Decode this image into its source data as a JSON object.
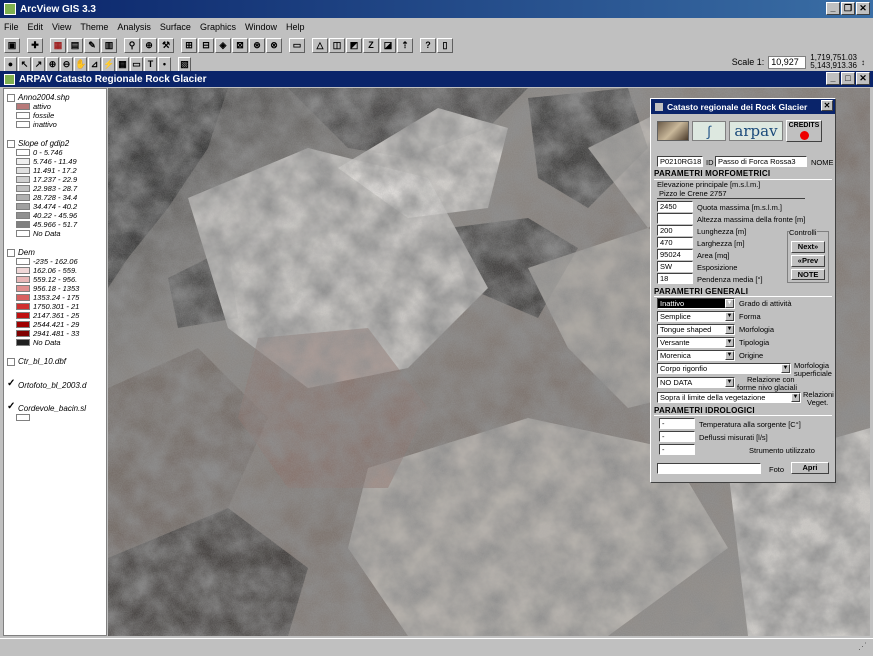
{
  "app": {
    "title": "ArcView GIS 3.3"
  },
  "menu": [
    "File",
    "Edit",
    "View",
    "Theme",
    "Analysis",
    "Surface",
    "Graphics",
    "Window",
    "Help"
  ],
  "toolbar": {
    "row1": [
      "save-icon",
      "add-theme-icon",
      "theme-props-icon",
      "legend-icon",
      "edit-icon",
      "table-icon",
      "zoom-full-icon",
      "zoom-active-icon",
      "zoom-selected-icon",
      "zoom-in-icon",
      "zoom-out-icon",
      "select-icon",
      "clear-icon",
      "query-icon",
      "locate-icon",
      "zoom-previous-icon",
      "layout-icon",
      "chart-icon",
      "triangle-icon",
      "chart2-icon",
      "chart3-icon",
      "text-icon",
      "bold-icon",
      "help-icon",
      "help2-icon"
    ],
    "row2": [
      "identify-icon",
      "pointer-icon",
      "vertex-icon",
      "zoom-in-tool-icon",
      "zoom-out-tool-icon",
      "pan-icon",
      "measure-icon",
      "hotlink-icon",
      "area-icon",
      "label-icon",
      "text-tool-icon",
      "draw-icon",
      "snap-icon"
    ]
  },
  "scale": {
    "label": "Scale 1:",
    "value": "10,927",
    "coord_x": "1,719,751.03",
    "coord_y": "5,143,913.36"
  },
  "view": {
    "title": "ARPAV Catasto Regionale Rock Glacier"
  },
  "toc": {
    "themes": [
      {
        "name": "Anno2004.shp",
        "checked": false,
        "legend": [
          {
            "label": "attivo",
            "color": "#b87a7a"
          },
          {
            "label": "fossile",
            "color": "#ffffff"
          },
          {
            "label": "inattivo",
            "color": "#ffffff"
          }
        ]
      },
      {
        "name": "Slope of gdip2",
        "checked": false,
        "legend": [
          {
            "label": "0 - 5.746",
            "color": "#ffffff"
          },
          {
            "label": "5.746 - 11.49",
            "color": "#f0f0f0"
          },
          {
            "label": "11.491 - 17.2",
            "color": "#e0e0e0"
          },
          {
            "label": "17.237 - 22.9",
            "color": "#d0d0d0"
          },
          {
            "label": "22.983 - 28.7",
            "color": "#c0c0c0"
          },
          {
            "label": "28.728 - 34.4",
            "color": "#b0b0b0"
          },
          {
            "label": "34.474 - 40.2",
            "color": "#a0a0a0"
          },
          {
            "label": "40.22 - 45.96",
            "color": "#909090"
          },
          {
            "label": "45.966 - 51.7",
            "color": "#808080"
          },
          {
            "label": "No Data",
            "color": "#ffffff"
          }
        ]
      },
      {
        "name": "Dem",
        "checked": false,
        "legend": [
          {
            "label": "-235 - 162.06",
            "color": "#ffffff"
          },
          {
            "label": "162.06 - 559.",
            "color": "#f0d8d8"
          },
          {
            "label": "559.12 - 956.",
            "color": "#e8b8b8"
          },
          {
            "label": "956.18 - 1353",
            "color": "#e09090"
          },
          {
            "label": "1353.24 - 175",
            "color": "#d86060"
          },
          {
            "label": "1750.301 - 21",
            "color": "#d03030"
          },
          {
            "label": "2147.361 - 25",
            "color": "#c01010"
          },
          {
            "label": "2544.421 - 29",
            "color": "#a00000"
          },
          {
            "label": "2941.481 - 33",
            "color": "#800000"
          },
          {
            "label": "No Data",
            "color": "#202020"
          }
        ]
      },
      {
        "name": "Ctr_bl_10.dbf",
        "checked": false,
        "legend": []
      },
      {
        "name": "Ortofoto_bl_2003.d",
        "checked": true,
        "legend": []
      },
      {
        "name": "Cordevole_bacin.sl",
        "checked": true,
        "legend": [
          {
            "label": "",
            "color": "#ffffff"
          }
        ]
      }
    ]
  },
  "panel": {
    "title": "Catasto regionale dei Rock Glacier",
    "logo_text": "arpav",
    "credits_label": "CREDITS",
    "code": "P0210RG18",
    "id_label": "ID",
    "nome_value": "Passo di Forca Rossa3",
    "nome_label": "NOME",
    "morfo_section": "PARAMETRI MORFOMETRICI",
    "elev_label": "Elevazione principale [m.s.l.m.]",
    "elev_value": "Pizzo le Crene 2757",
    "fields": [
      {
        "value": "2450",
        "label": "Quota massima [m.s.l.m.]"
      },
      {
        "value": "",
        "label": "Altezza massima della fronte [m]"
      },
      {
        "value": "200",
        "label": "Lunghezza [m]"
      },
      {
        "value": "470",
        "label": "Larghezza [m]"
      },
      {
        "value": "95024",
        "label": "Area [mq]"
      },
      {
        "value": "SW",
        "label": "Esposizione"
      },
      {
        "value": "18",
        "label": "Pendenza media [°]"
      }
    ],
    "controlli_label": "Controlli",
    "next_label": "Next",
    "prev_label": "Prev",
    "note_label": "NOTE",
    "generali_section": "PARAMETRI GENERALI",
    "combos": [
      {
        "value": "Inattivo",
        "label": "Grado di attività",
        "dark": true
      },
      {
        "value": "Semplice",
        "label": "Forma"
      },
      {
        "value": "Tongue shaped",
        "label": "Morfologia"
      },
      {
        "value": "Versante",
        "label": "Tipologia"
      },
      {
        "value": "Morenica",
        "label": "Origine"
      }
    ],
    "corpo_value": "Corpo rigonfio",
    "morf_sup_label_1": "Morfologia",
    "morf_sup_label_2": "superficiale",
    "nodata_value": "NO DATA",
    "relazione_label_1": "Relazione con",
    "relazione_label_2": "forme nivo glaciali",
    "veget_value": "Sopra il limite della vegetazione",
    "rel_veg_1": "Relazioni",
    "rel_veg_2": "Veget.",
    "idro_section": "PARAMETRI IDROLOGICI",
    "idro": [
      {
        "value": "-",
        "label": "Temperatura alla sorgente [C°]"
      },
      {
        "value": "-",
        "label": "Deflussi misurati [l/s]"
      },
      {
        "value": "-",
        "label": "Strumento utilizzato"
      }
    ],
    "foto_label": "Foto",
    "apri_label": "Apri"
  }
}
